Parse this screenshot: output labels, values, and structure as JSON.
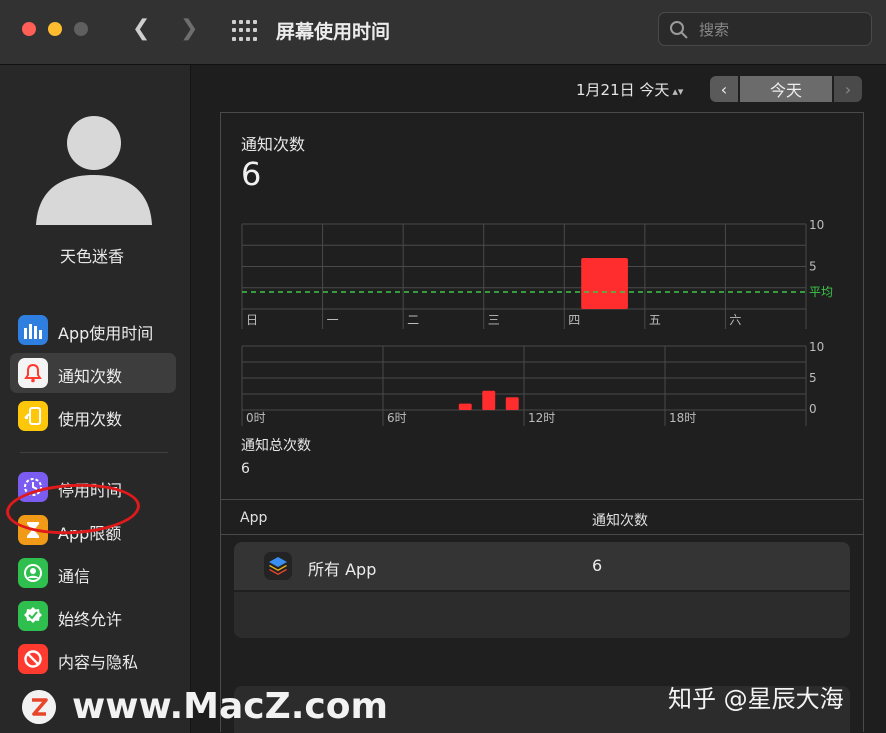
{
  "window": {
    "title": "屏幕使用时间"
  },
  "search": {
    "placeholder": "搜索"
  },
  "sidebar": {
    "username": "天色迷香",
    "items": [
      {
        "label": "App使用时间"
      },
      {
        "label": "通知次数"
      },
      {
        "label": "使用次数"
      },
      {
        "label": "停用时间"
      },
      {
        "label": "App限额"
      },
      {
        "label": "通信"
      },
      {
        "label": "始终允许"
      },
      {
        "label": "内容与隐私"
      }
    ]
  },
  "date_picker": {
    "label": "1月21日 今天",
    "today_button": "今天"
  },
  "summary": {
    "notifications_label": "通知次数",
    "notifications_value": "6"
  },
  "chart_data": [
    {
      "type": "bar",
      "categories": [
        "日",
        "一",
        "二",
        "三",
        "四",
        "五",
        "六"
      ],
      "values": [
        0,
        0,
        0,
        0,
        6,
        0,
        0
      ],
      "y_ticks": [
        "10",
        "5"
      ],
      "average_label": "平均",
      "ylim": [
        0,
        10
      ]
    },
    {
      "type": "bar",
      "x_ticks": [
        "0时",
        "6时",
        "12时",
        "18时"
      ],
      "y_ticks": [
        "10",
        "5",
        "0"
      ],
      "hours": [
        9,
        10,
        11
      ],
      "values": [
        1,
        3,
        2
      ],
      "ylim": [
        0,
        10
      ]
    }
  ],
  "totals": {
    "label": "通知总次数",
    "value": "6"
  },
  "table": {
    "columns": [
      "App",
      "通知次数"
    ],
    "rows": [
      {
        "app": "所有 App",
        "count": "6"
      }
    ]
  },
  "watermark": {
    "site": "www.MacZ.com",
    "credit": "知乎 @星辰大海"
  },
  "colors": {
    "accent_red": "#ff2d2d",
    "average_line": "#3cc84a"
  }
}
